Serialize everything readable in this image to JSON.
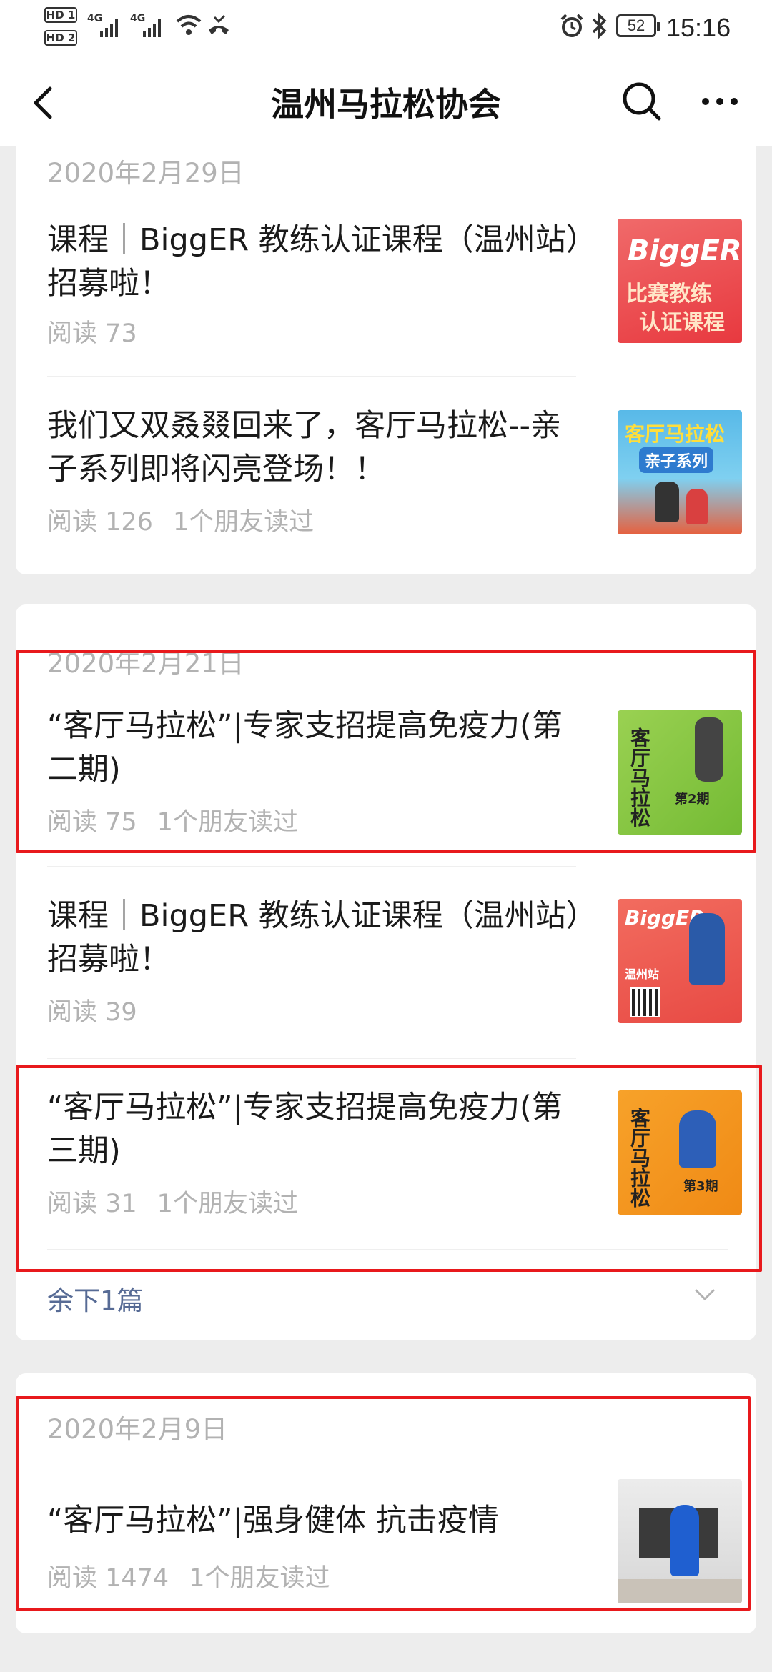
{
  "status_bar": {
    "hd1": "HD 1",
    "hd2": "HD 2",
    "net1": "4G",
    "net2": "4G",
    "battery": "52",
    "time": "15:16"
  },
  "nav": {
    "title": "温州马拉松协会",
    "back_icon": "chevron-left-icon",
    "search_icon": "search-icon",
    "more_icon": "more-dots-icon"
  },
  "groups": [
    {
      "date": "2020年2月29日",
      "articles": [
        {
          "title": "课程｜BiggER 教练认证课程（温州站）招募啦！",
          "reads": "阅读 73",
          "friends": "",
          "thumb": {
            "label1": "BiggER",
            "label2": "比赛教练",
            "label3": "认证课程"
          }
        },
        {
          "title": "我们又双叒叕回来了，客厅马拉松--亲子系列即将闪亮登场！！",
          "reads": "阅读 126",
          "friends": "1个朋友读过",
          "thumb": {
            "label1": "客厅马拉松",
            "label2": "亲子系列"
          }
        }
      ]
    },
    {
      "date": "2020年2月21日",
      "articles": [
        {
          "title": "“客厅马拉松”|专家支招提高免疫力(第二期)",
          "reads": "阅读 75",
          "friends": "1个朋友读过",
          "thumb": {
            "label1": "客厅马拉松",
            "label2": "第2期"
          }
        },
        {
          "title": "课程｜BiggER 教练认证课程（温州站）招募啦！",
          "reads": "阅读 39",
          "friends": "",
          "thumb": {
            "label1": "BiggER",
            "label2": "温州站"
          }
        },
        {
          "title": "“客厅马拉松”|专家支招提高免疫力(第三期)",
          "reads": "阅读 31",
          "friends": "1个朋友读过",
          "thumb": {
            "label1": "客厅马拉松",
            "label2": "第3期"
          }
        }
      ],
      "more": "余下1篇"
    },
    {
      "date": "2020年2月9日",
      "articles": [
        {
          "title": "“客厅马拉松”|强身健体 抗击疫情",
          "reads": "阅读 1474",
          "friends": "1个朋友读过",
          "thumb": {}
        }
      ]
    }
  ],
  "colors": {
    "highlight_box": "#e8191c",
    "link": "#576b95",
    "meta": "#b2b2b2",
    "background": "#ededed"
  }
}
